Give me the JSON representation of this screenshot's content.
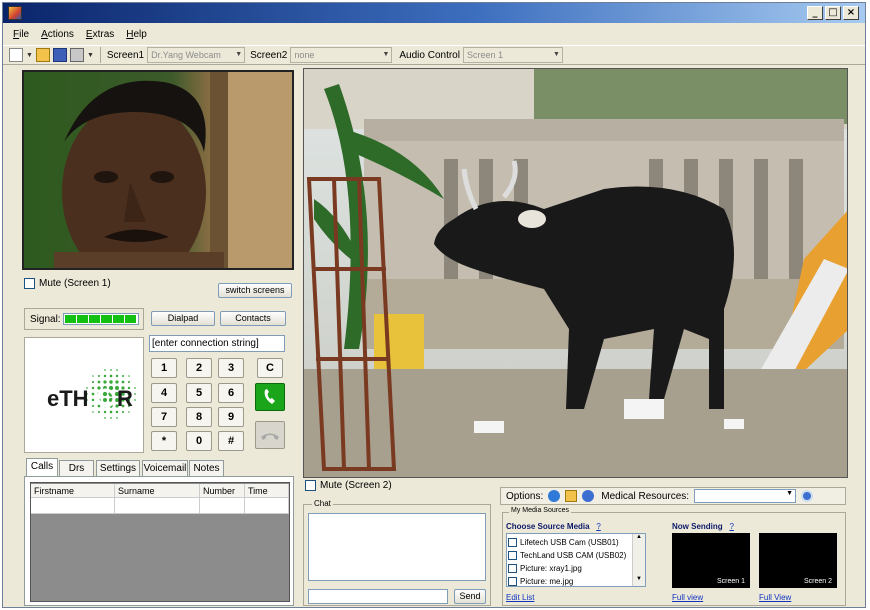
{
  "window": {
    "controls": [
      "_",
      "□",
      "×"
    ]
  },
  "menu": [
    "File",
    "Actions",
    "Extras",
    "Help"
  ],
  "toolbar": {
    "screen1_label": "Screen1",
    "screen1_value": "Dr.Yang Webcam",
    "screen2_label": "Screen2",
    "screen2_value": "none",
    "audio_label": "Audio Control",
    "audio_value": "Screen 1",
    "icons": [
      "new-icon",
      "open-icon",
      "save-icon",
      "print-icon"
    ]
  },
  "left": {
    "mute1_label": "Mute (Screen 1)",
    "switch_label": "switch screens",
    "signal_label": "Signal:",
    "signal_bars": 6,
    "dialpad_label": "Dialpad",
    "contacts_label": "Contacts",
    "connection_value": "[enter connection string]",
    "logo_text_left": "eTH",
    "logo_text_right": "R",
    "keys": [
      "1",
      "2",
      "3",
      "C",
      "4",
      "5",
      "6",
      "7",
      "8",
      "9",
      "*",
      "0",
      "#"
    ],
    "tabs": [
      "Calls",
      "Drs",
      "Settings",
      "Voicemail",
      "Notes"
    ],
    "columns": [
      "Firstname",
      "Surname",
      "Number",
      "Time"
    ]
  },
  "right": {
    "mute2_label": "Mute (Screen 2)",
    "chat_label": "Chat",
    "send_label": "Send",
    "options_label": "Options:",
    "medical_label": "Medical Resources:",
    "my_media_label": "My Media Sources",
    "choose_source_label": "Choose Source Media",
    "help_mark": "?",
    "now_sending_label": "Now Sending",
    "media_items": [
      "Lifetech USB Cam (USB01)",
      "TechLand USB CAM (USB02)",
      "Picture: xray1.jpg",
      "Picture: me.jpg"
    ],
    "edit_list_label": "Edit List",
    "preview1_label": "Screen 1",
    "preview2_label": "Screen 2",
    "full_view_label": "Full view",
    "full_view2_label": "Full View"
  },
  "colors": {
    "signal_green": "#12c012",
    "call_green": "#1aa51a",
    "logo_green": "#3aa83a"
  }
}
